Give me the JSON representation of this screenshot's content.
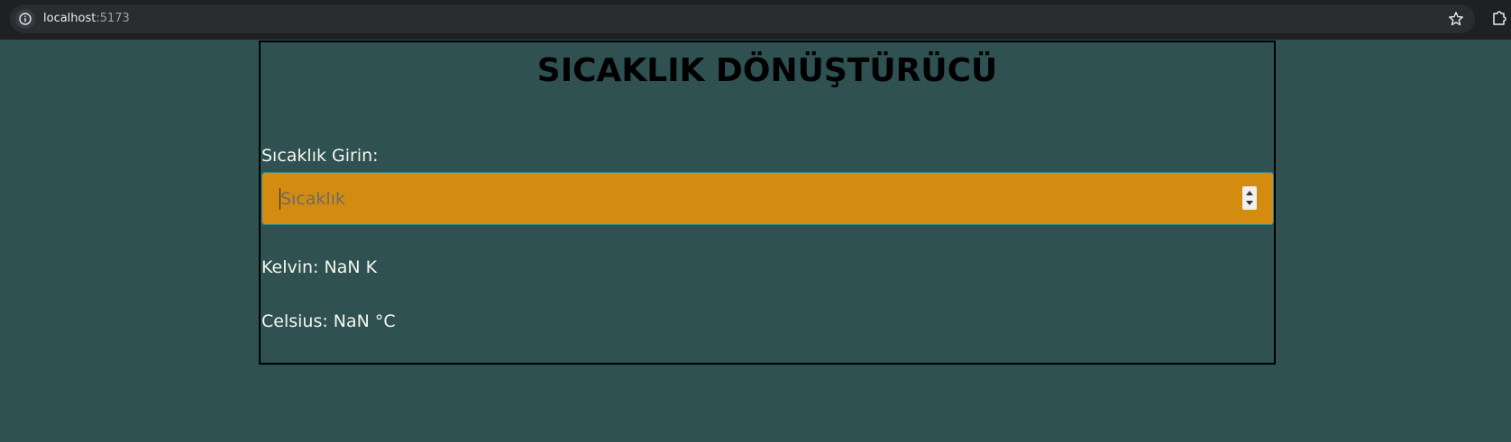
{
  "browser": {
    "url_host": "localhost",
    "url_port": ":5173",
    "info_icon": "info-icon",
    "star_icon": "star-icon",
    "extensions_icon": "puzzle-icon"
  },
  "page": {
    "title": "SICAKLIK DÖNÜŞTÜRÜCÜ",
    "input_label": "Sıcaklık Girin:",
    "input_placeholder": "Sıcaklık",
    "input_value": "",
    "kelvin_text": "Kelvin: NaN K",
    "celsius_text": "Celsius: NaN °C"
  },
  "colors": {
    "background": "#2f5151",
    "input_background": "#d48c10",
    "text": "#f4f7f0",
    "title": "#000000"
  }
}
